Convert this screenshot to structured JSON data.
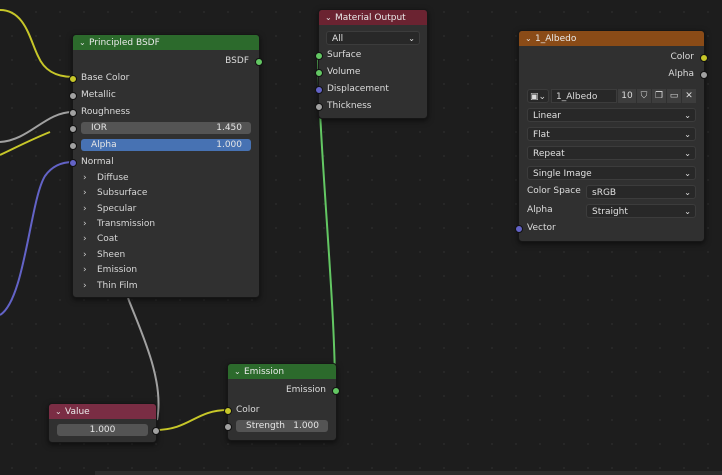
{
  "colors": {
    "background": "#1d1d1d",
    "shader_header": "#2c6a2c",
    "output_header": "#6b2331",
    "texture_header": "#8a4b17",
    "value_header": "#7a2d44",
    "socket_color": "#c7c729",
    "socket_shader": "#63c763",
    "socket_float": "#a1a1a1",
    "socket_vector": "#6363c7",
    "alpha_field": "#4772b3"
  },
  "principled": {
    "title": "Principled BSDF",
    "output": "BSDF",
    "inputs": {
      "base_color": "Base Color",
      "metallic": "Metallic",
      "roughness": "Roughness",
      "ior_label": "IOR",
      "ior_value": "1.450",
      "alpha_label": "Alpha",
      "alpha_value": "1.000",
      "normal": "Normal"
    },
    "panels": [
      "Diffuse",
      "Subsurface",
      "Specular",
      "Transmission",
      "Coat",
      "Sheen",
      "Emission",
      "Thin Film"
    ]
  },
  "material_output": {
    "title": "Material Output",
    "target": "All",
    "inputs": [
      "Surface",
      "Volume",
      "Displacement",
      "Thickness"
    ]
  },
  "image_texture": {
    "title": "1_Albedo",
    "outputs": {
      "color": "Color",
      "alpha": "Alpha"
    },
    "image_name": "1_Albedo",
    "users": "10",
    "interpolation": "Linear",
    "projection": "Flat",
    "extension": "Repeat",
    "source": "Single Image",
    "color_space_label": "Color Space",
    "color_space": "sRGB",
    "alpha_label": "Alpha",
    "alpha_mode": "Straight",
    "vector": "Vector"
  },
  "emission": {
    "title": "Emission",
    "output": "Emission",
    "color_label": "Color",
    "strength_label": "Strength",
    "strength_value": "1.000"
  },
  "value_node": {
    "title": "Value",
    "value": "1.000"
  },
  "icons": {
    "chevron": "chevron-down-icon",
    "panel": "chevron-right-icon",
    "image": "image-icon",
    "shield": "fake-user-icon",
    "new": "new-image-icon",
    "folder": "folder-icon",
    "close": "close-icon"
  }
}
